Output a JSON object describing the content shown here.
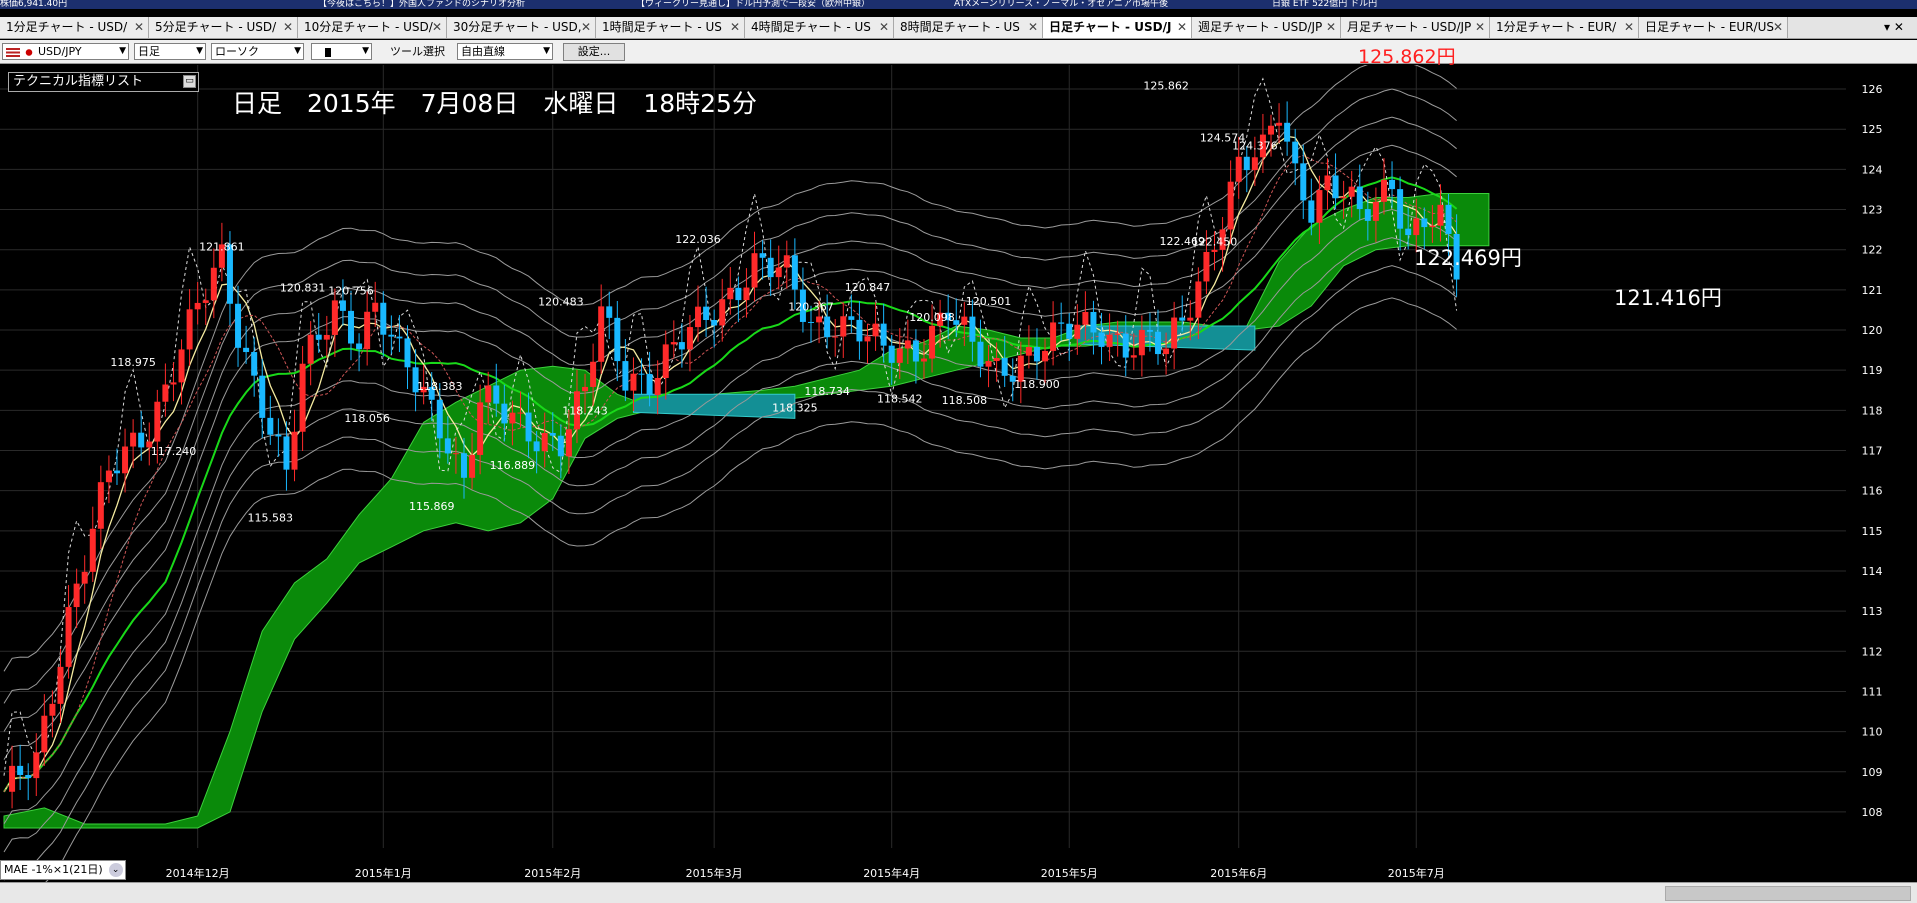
{
  "browser_tabs": [
    {
      "label": "株価6,941.40円"
    },
    {
      "label": "【今夜はこちら！】外国人ファンドのシナリオ分析"
    },
    {
      "label": "【ウィークリー見通し】ドル円予測で一段安（欧州中銀）"
    },
    {
      "label": "ATXメーンリリース・ノーマル・オセアニア市場午後"
    },
    {
      "label": "日銀 ETF 522億円 ドル円"
    }
  ],
  "chart_tabs": [
    {
      "label": "1分足チャート - USD/"
    },
    {
      "label": "5分足チャート - USD/"
    },
    {
      "label": "10分足チャート - USD/"
    },
    {
      "label": "30分足チャート - USD,"
    },
    {
      "label": "1時間足チャート - US"
    },
    {
      "label": "4時間足チャート - US"
    },
    {
      "label": "8時間足チャート - US"
    },
    {
      "label": "日足チャート - USD/J",
      "active": true
    },
    {
      "label": "週足チャート - USD/JP"
    },
    {
      "label": "月足チャート - USD/JP"
    },
    {
      "label": "1分足チャート - EUR/"
    },
    {
      "label": "日足チャート - EUR/US"
    }
  ],
  "tab_controls": "▾ ✕",
  "toolbar": {
    "symbol": "USD/JPY",
    "timeframe": "日足",
    "chart_style": "ローソク",
    "tool_label": "ツール選択",
    "drawing_tool": "自由直線",
    "settings_button": "設定..."
  },
  "overlay": {
    "tech_list_label": "テクニカル指標リスト",
    "date_heading": "日足　2015年　7月08日　水曜日　18時25分",
    "top_price": "125.862円",
    "mid_price": "122.469円",
    "current_price": "121.416円",
    "mae_label": "MAE -1%×1(21日)"
  },
  "chart_data": {
    "type": "candlestick",
    "instrument": "USD/JPY",
    "y_ticks": [
      108,
      109,
      110,
      111,
      112,
      113,
      114,
      115,
      116,
      117,
      118,
      119,
      120,
      121,
      122,
      123,
      124,
      125,
      126
    ],
    "ylim": [
      107.6,
      126.3
    ],
    "x_ticks": [
      {
        "label": "2014年12月",
        "idx": 24
      },
      {
        "label": "2015年1月",
        "idx": 47
      },
      {
        "label": "2015年2月",
        "idx": 68
      },
      {
        "label": "2015年3月",
        "idx": 88
      },
      {
        "label": "2015年4月",
        "idx": 110
      },
      {
        "label": "2015年5月",
        "idx": 132
      },
      {
        "label": "2015年6月",
        "idx": 153
      },
      {
        "label": "2015年7月",
        "idx": 175
      }
    ],
    "close_anchors": [
      [
        0,
        108.3
      ],
      [
        4,
        109.3
      ],
      [
        8,
        113.0
      ],
      [
        13,
        116.3
      ],
      [
        18,
        117.7
      ],
      [
        22,
        119.6
      ],
      [
        27,
        121.7
      ],
      [
        29,
        120.0
      ],
      [
        32,
        118.3
      ],
      [
        35,
        116.3
      ],
      [
        37,
        118.9
      ],
      [
        41,
        120.7
      ],
      [
        44,
        119.9
      ],
      [
        46,
        120.5
      ],
      [
        49,
        119.2
      ],
      [
        52,
        118.5
      ],
      [
        55,
        117.4
      ],
      [
        57,
        116.2
      ],
      [
        59,
        118.1
      ],
      [
        63,
        117.8
      ],
      [
        66,
        117.5
      ],
      [
        69,
        117.2
      ],
      [
        72,
        118.3
      ],
      [
        74,
        120.4
      ],
      [
        77,
        119.0
      ],
      [
        80,
        118.8
      ],
      [
        83,
        119.4
      ],
      [
        86,
        120.1
      ],
      [
        89,
        120.8
      ],
      [
        93,
        121.6
      ],
      [
        97,
        121.3
      ],
      [
        100,
        120.2
      ],
      [
        103,
        120.3
      ],
      [
        106,
        119.9
      ],
      [
        109,
        119.4
      ],
      [
        113,
        119.6
      ],
      [
        117,
        120.5
      ],
      [
        120,
        119.4
      ],
      [
        123,
        119.0
      ],
      [
        126,
        119.4
      ],
      [
        130,
        119.7
      ],
      [
        133,
        120.0
      ],
      [
        136,
        120.1
      ],
      [
        139,
        119.7
      ],
      [
        142,
        119.6
      ],
      [
        144,
        119.4
      ],
      [
        146,
        120.2
      ],
      [
        148,
        121.3
      ],
      [
        150,
        122.4
      ],
      [
        153,
        124.0
      ],
      [
        156,
        124.3
      ],
      [
        158,
        125.5
      ],
      [
        160,
        124.0
      ],
      [
        162,
        123.2
      ],
      [
        164,
        123.6
      ],
      [
        166,
        123.3
      ],
      [
        168,
        122.7
      ],
      [
        170,
        123.2
      ],
      [
        172,
        123.8
      ],
      [
        174,
        122.4
      ],
      [
        176,
        122.8
      ],
      [
        178,
        122.6
      ],
      [
        180,
        121.4
      ]
    ],
    "labels": [
      {
        "text": "121.861",
        "idx": 27,
        "value": 121.861,
        "pos": "above"
      },
      {
        "text": "120.831",
        "idx": 37,
        "value": 120.831,
        "pos": "above"
      },
      {
        "text": "120.756",
        "idx": 43,
        "value": 120.756,
        "pos": "above"
      },
      {
        "text": "118.975",
        "idx": 16,
        "value": 118.975,
        "pos": "above"
      },
      {
        "text": "117.240",
        "idx": 21,
        "value": 117.24,
        "pos": "below"
      },
      {
        "text": "115.583",
        "idx": 33,
        "value": 115.583,
        "pos": "below"
      },
      {
        "text": "118.056",
        "idx": 45,
        "value": 118.056,
        "pos": "below"
      },
      {
        "text": "118.383",
        "idx": 54,
        "value": 118.383,
        "pos": "above"
      },
      {
        "text": "115.869",
        "idx": 53,
        "value": 115.869,
        "pos": "below"
      },
      {
        "text": "116.889",
        "idx": 63,
        "value": 116.889,
        "pos": "below"
      },
      {
        "text": "120.483",
        "idx": 69,
        "value": 120.483,
        "pos": "above"
      },
      {
        "text": "118.243",
        "idx": 72,
        "value": 118.243,
        "pos": "below"
      },
      {
        "text": "122.036",
        "idx": 86,
        "value": 122.036,
        "pos": "above"
      },
      {
        "text": "120.367",
        "idx": 100,
        "value": 120.367,
        "pos": "above"
      },
      {
        "text": "118.325",
        "idx": 98,
        "value": 118.325,
        "pos": "below"
      },
      {
        "text": "118.734",
        "idx": 102,
        "value": 118.734,
        "pos": "below"
      },
      {
        "text": "120.847",
        "idx": 107,
        "value": 120.847,
        "pos": "above"
      },
      {
        "text": "118.542",
        "idx": 111,
        "value": 118.542,
        "pos": "below"
      },
      {
        "text": "120.098",
        "idx": 115,
        "value": 120.098,
        "pos": "above"
      },
      {
        "text": "118.508",
        "idx": 119,
        "value": 118.508,
        "pos": "below"
      },
      {
        "text": "120.501",
        "idx": 122,
        "value": 120.501,
        "pos": "above"
      },
      {
        "text": "118.900",
        "idx": 128,
        "value": 118.9,
        "pos": "below"
      },
      {
        "text": "125.862",
        "idx": 144,
        "value": 125.862,
        "pos": "above"
      },
      {
        "text": "124.574",
        "idx": 151,
        "value": 124.574,
        "pos": "above"
      },
      {
        "text": "124.376",
        "idx": 155,
        "value": 124.376,
        "pos": "above"
      },
      {
        "text": "122.469",
        "idx": 146,
        "value": 122.469,
        "pos": "below"
      },
      {
        "text": "122.450",
        "idx": 150,
        "value": 122.45,
        "pos": "below"
      }
    ],
    "cloud_green": [
      [
        0,
        107.9
      ],
      [
        5,
        108.1
      ],
      [
        10,
        107.7
      ],
      [
        15,
        107.7
      ],
      [
        20,
        107.7
      ],
      [
        24,
        107.9
      ],
      [
        28,
        110.0
      ],
      [
        32,
        112.5
      ],
      [
        36,
        113.7
      ],
      [
        40,
        114.3
      ],
      [
        44,
        115.4
      ],
      [
        48,
        116.3
      ],
      [
        52,
        117.7
      ],
      [
        56,
        118.2
      ],
      [
        60,
        118.6
      ],
      [
        64,
        119.0
      ],
      [
        68,
        119.1
      ],
      [
        72,
        119.0
      ],
      [
        76,
        118.4
      ],
      [
        80,
        118.1
      ],
      [
        84,
        118.2
      ],
      [
        88,
        118.4
      ],
      [
        94,
        118.5
      ],
      [
        98,
        118.6
      ],
      [
        102,
        118.8
      ],
      [
        106,
        119.0
      ],
      [
        110,
        119.5
      ],
      [
        114,
        119.7
      ],
      [
        118,
        120.1
      ],
      [
        122,
        120.0
      ],
      [
        126,
        119.8
      ],
      [
        130,
        119.8
      ],
      [
        134,
        120.1
      ],
      [
        138,
        120.2
      ],
      [
        142,
        120.2
      ],
      [
        146,
        120.2
      ],
      [
        150,
        120.1
      ],
      [
        154,
        120.1
      ],
      [
        158,
        121.7
      ],
      [
        162,
        122.6
      ],
      [
        166,
        123.0
      ],
      [
        170,
        123.3
      ],
      [
        174,
        123.3
      ],
      [
        178,
        123.4
      ],
      [
        182,
        123.4
      ],
      [
        184,
        123.4
      ]
    ],
    "cloud_bottom": [
      [
        0,
        107.6
      ],
      [
        24,
        107.6
      ],
      [
        28,
        108.0
      ],
      [
        32,
        110.5
      ],
      [
        36,
        112.3
      ],
      [
        40,
        113.2
      ],
      [
        44,
        114.2
      ],
      [
        48,
        114.6
      ],
      [
        52,
        115.0
      ],
      [
        56,
        115.2
      ],
      [
        60,
        115.0
      ],
      [
        64,
        115.2
      ],
      [
        68,
        115.8
      ],
      [
        72,
        117.3
      ],
      [
        76,
        117.8
      ],
      [
        80,
        118.0
      ],
      [
        84,
        118.1
      ],
      [
        88,
        118.2
      ],
      [
        94,
        118.2
      ],
      [
        98,
        118.3
      ],
      [
        102,
        118.4
      ],
      [
        106,
        118.5
      ],
      [
        110,
        118.6
      ],
      [
        114,
        118.8
      ],
      [
        118,
        119.0
      ],
      [
        122,
        119.2
      ],
      [
        126,
        119.4
      ],
      [
        130,
        119.6
      ],
      [
        134,
        119.6
      ],
      [
        138,
        119.7
      ],
      [
        142,
        119.8
      ],
      [
        146,
        119.8
      ],
      [
        150,
        120.0
      ],
      [
        154,
        120.0
      ],
      [
        158,
        120.1
      ],
      [
        162,
        120.6
      ],
      [
        166,
        121.6
      ],
      [
        170,
        122.0
      ],
      [
        174,
        122.1
      ],
      [
        178,
        122.1
      ],
      [
        182,
        122.1
      ],
      [
        184,
        122.1
      ]
    ]
  }
}
